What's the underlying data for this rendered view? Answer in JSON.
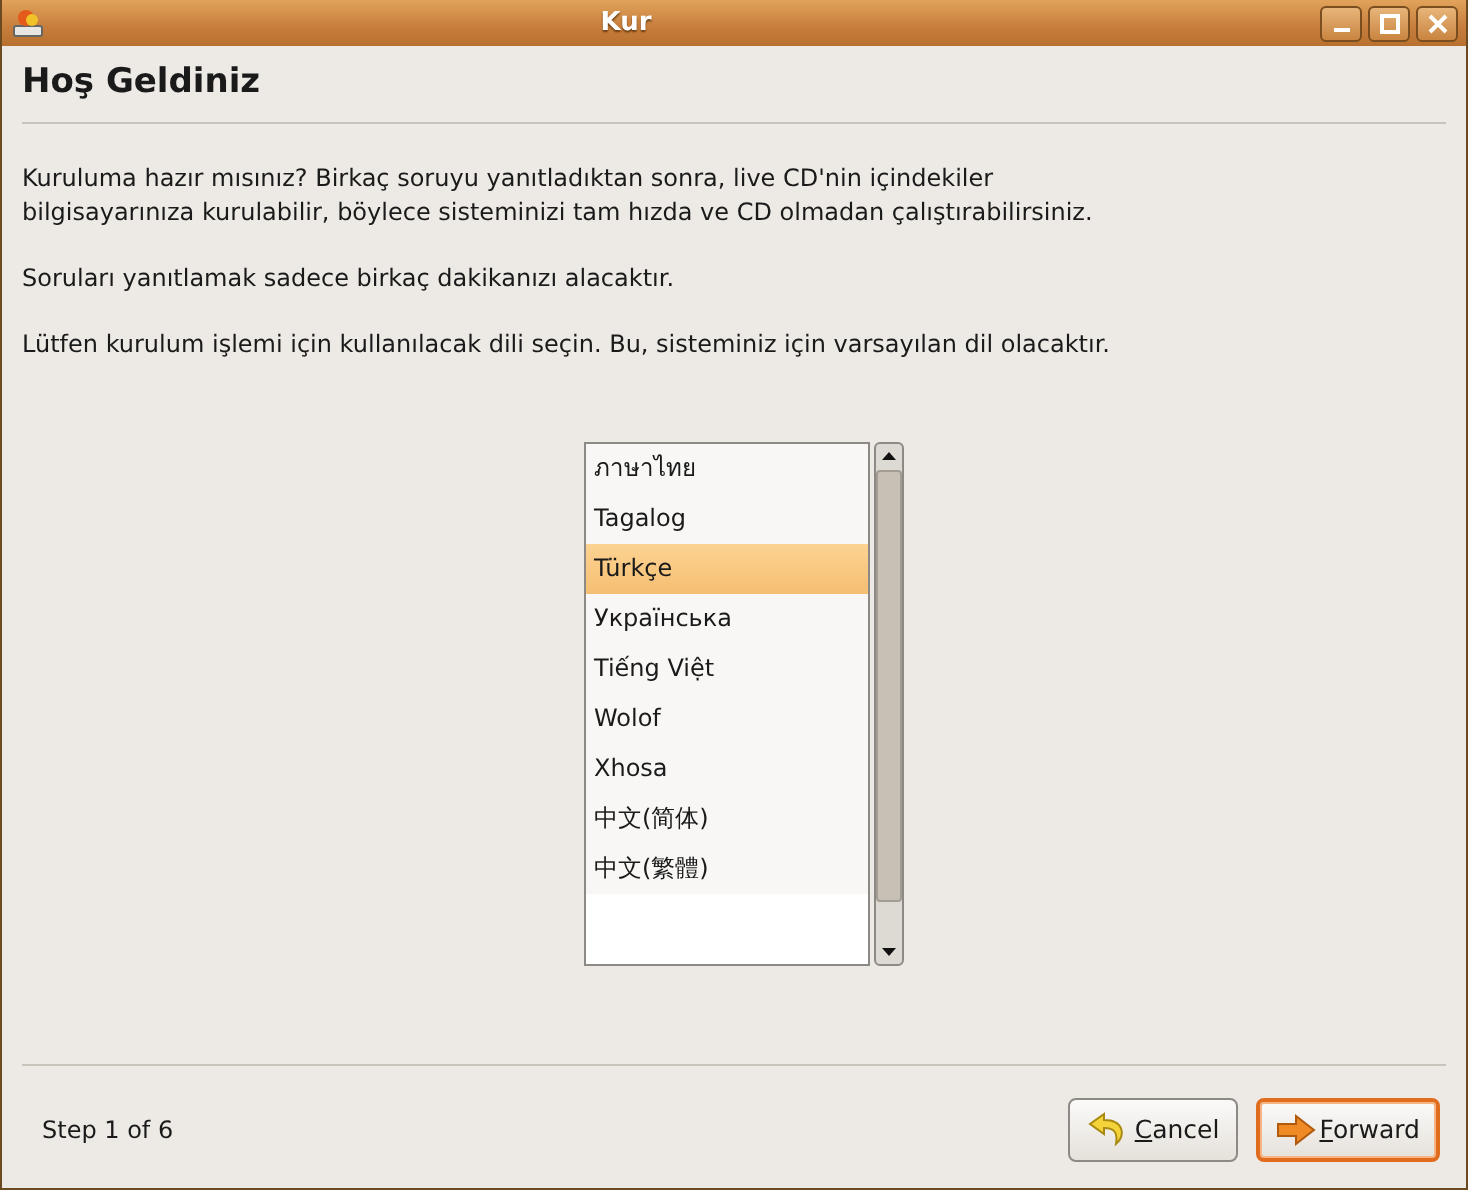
{
  "window": {
    "title": "Kur"
  },
  "heading": "Hoş Geldiniz",
  "paragraphs": [
    "Kuruluma hazır mısınız? Birkaç soruyu yanıtladıktan sonra, live CD'nin içindekiler bilgisayarınıza kurulabilir, böylece sisteminizi tam hızda ve CD olmadan çalıştırabilirsiniz.",
    "Soruları yanıtlamak sadece birkaç dakikanızı alacaktır.",
    "Lütfen kurulum işlemi için kullanılacak dili seçin. Bu, sisteminiz için varsayılan dil olacaktır."
  ],
  "languages": [
    {
      "label": "ภาษาไทย",
      "selected": false
    },
    {
      "label": "Tagalog",
      "selected": false
    },
    {
      "label": "Türkçe",
      "selected": true
    },
    {
      "label": "Українська",
      "selected": false
    },
    {
      "label": "Tiếng Việt",
      "selected": false
    },
    {
      "label": "Wolof",
      "selected": false
    },
    {
      "label": "Xhosa",
      "selected": false
    },
    {
      "label": "中文(简体)",
      "selected": false
    },
    {
      "label": "中文(繁體)",
      "selected": false
    }
  ],
  "status": "Step 1 of 6",
  "buttons": [
    {
      "kind": "cancel",
      "label": "Cancel",
      "default": false
    },
    {
      "kind": "forward",
      "label": "Forward",
      "default": true
    }
  ]
}
